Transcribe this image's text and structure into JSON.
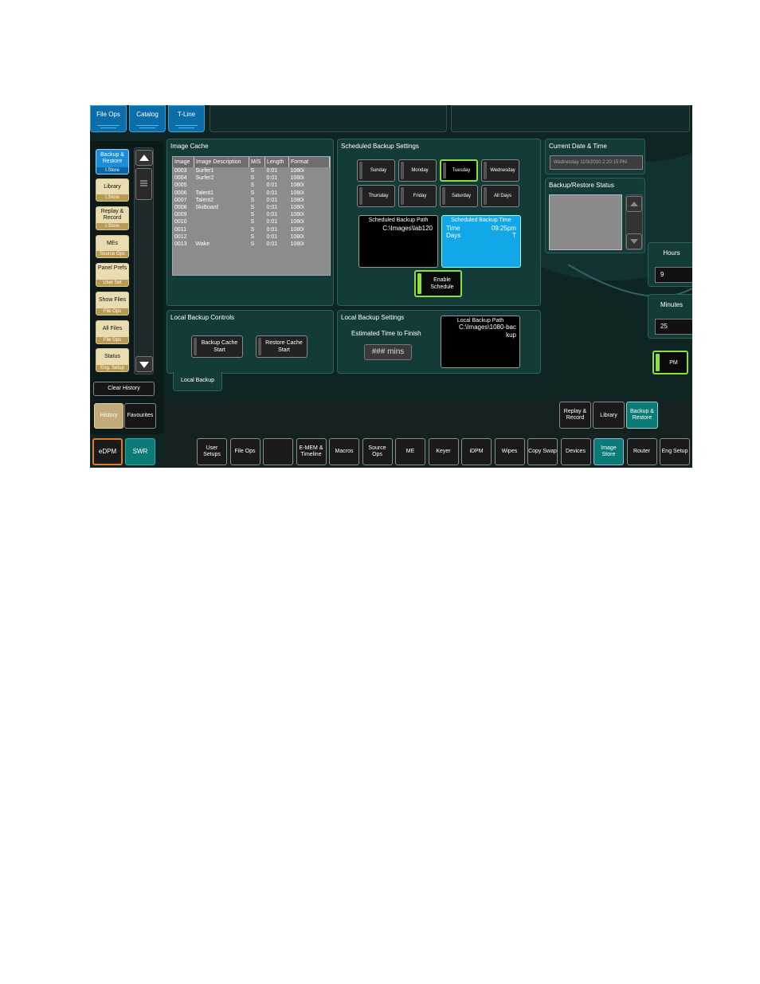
{
  "top_tabs": [
    "File Ops",
    "Catalog",
    "T-Line"
  ],
  "nav": {
    "items": [
      {
        "label": "Backup & Restore",
        "sub": "I.Store",
        "active": true
      },
      {
        "label": "Library",
        "sub": "I.Store",
        "active": false
      },
      {
        "label": "Replay & Record",
        "sub": "I.Store",
        "active": false
      },
      {
        "label": "MEs",
        "sub": "Source Ops",
        "active": false
      },
      {
        "label": "Panel Prefs",
        "sub": "User Set",
        "active": false
      },
      {
        "label": "Show Files",
        "sub": "File Ops",
        "active": false
      },
      {
        "label": "All Files",
        "sub": "File Ops",
        "active": false
      },
      {
        "label": "Status",
        "sub": "Eng. Setup",
        "active": false
      }
    ],
    "clear_history": "Clear History",
    "history": "History",
    "favourites": "Favourites",
    "edpm": "eDPM",
    "swr": "SWR"
  },
  "image_cache": {
    "title": "Image Cache",
    "columns": [
      "Image",
      "Image Description",
      "M/S",
      "Length",
      "Format"
    ],
    "rows": [
      [
        "0003",
        "Surfer1",
        "S",
        "0:01",
        "1080i"
      ],
      [
        "0004",
        "Surfer2",
        "S",
        "0:01",
        "1080i"
      ],
      [
        "0005",
        "",
        "S",
        "0:01",
        "1080i"
      ],
      [
        "0006",
        "Talent1",
        "S",
        "0:01",
        "1080i"
      ],
      [
        "0007",
        "Talent2",
        "S",
        "0:01",
        "1080i"
      ],
      [
        "0008",
        "SkiBoard",
        "S",
        "0:01",
        "1080i"
      ],
      [
        "0009",
        "",
        "S",
        "0:01",
        "1080i"
      ],
      [
        "0010",
        "",
        "S",
        "0:01",
        "1080i"
      ],
      [
        "0011",
        "",
        "S",
        "0:01",
        "1080i"
      ],
      [
        "0012",
        "",
        "S",
        "0:01",
        "1080i"
      ],
      [
        "0013",
        "Wake",
        "S",
        "0:01",
        "1080i"
      ]
    ]
  },
  "scheduled": {
    "title": "Scheduled Backup Settings",
    "days": [
      "Sunday",
      "Monday",
      "Tuesday",
      "Wednesday",
      "Thursday",
      "Friday",
      "Saturday",
      "All Days"
    ],
    "selected_day": "Tuesday",
    "path_title": "Scheduled Backup Path",
    "path_value": "C:\\Images\\lab120",
    "time_title": "Scheduled Backup Time",
    "time_label": "Time",
    "time_value": "09:25pm",
    "days_label": "Days",
    "days_value": "T",
    "enable_label": "Enable Schedule"
  },
  "current_date": {
    "title": "Current Date & Time",
    "value": "Wednesday 11/3/2010 2:20:15 PM"
  },
  "status": {
    "title": "Backup/Restore Status"
  },
  "hours": {
    "label": "Hours",
    "value": "9"
  },
  "minutes": {
    "label": "Minutes",
    "value": "25"
  },
  "pm_label": "PM",
  "local_controls": {
    "title": "Local Backup Controls",
    "backup_label": "Backup Cache Start",
    "restore_label": "Restore Cache Start",
    "tab": "Local Backup"
  },
  "local_settings": {
    "title": "Local Backup Settings",
    "estimate_label": "Estimated Time to Finish",
    "estimate_value": "### mins",
    "path_title": "Local Backup Path",
    "path_value": "C:\\Images\\1080-backup"
  },
  "sub_tabs": [
    "Replay & Record",
    "Library",
    "Backup & Restore"
  ],
  "bottom_tabs": [
    "User Setups",
    "File Ops",
    "",
    "E-MEM & Timeline",
    "Macros",
    "Source Ops",
    "ME",
    "Keyer",
    "iDPM",
    "Wipes",
    "Copy Swap",
    "Devices",
    "Image Store",
    "Router",
    "Eng Setup"
  ],
  "active_bottom_tab": "Image Store"
}
